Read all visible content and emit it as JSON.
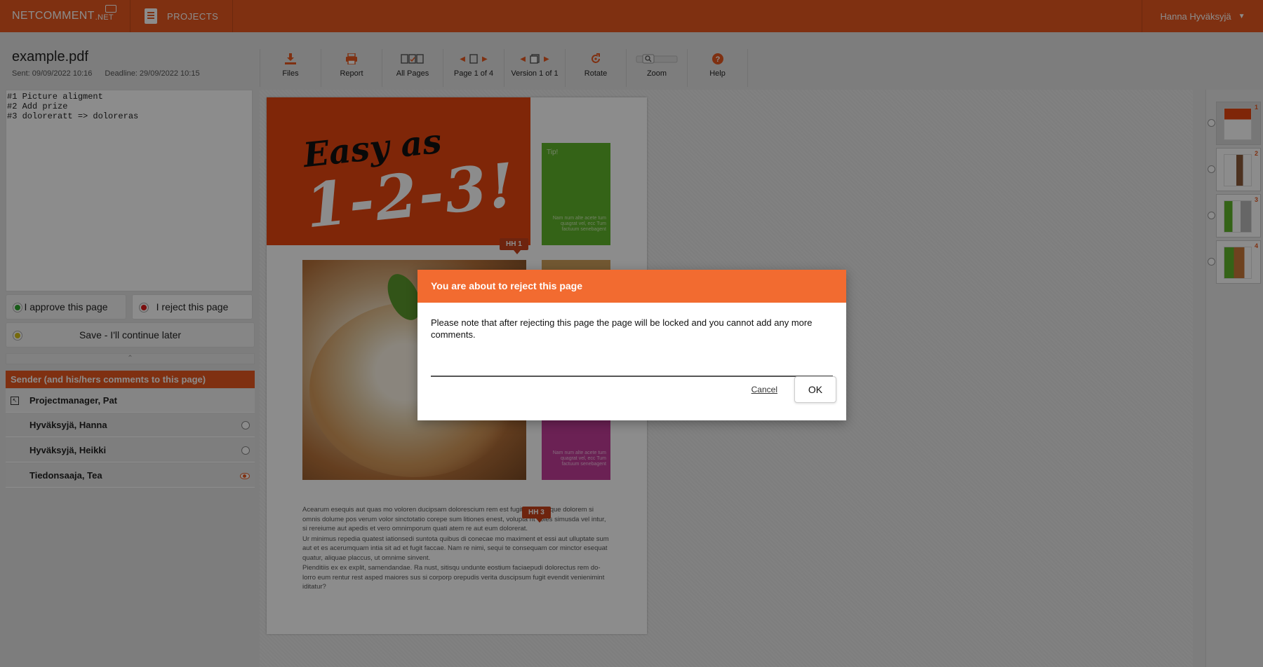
{
  "app": {
    "logo_text": "NETCOMMENT",
    "logo_suffix": ".NET",
    "projects_label": "PROJECTS",
    "user_name": "Hanna Hyväksyjä",
    "user_caret": "▼"
  },
  "file": {
    "name": "example.pdf",
    "sent": "Sent: 09/09/2022 10:16",
    "deadline": "Deadline: 29/09/2022 10:15"
  },
  "toolbar": {
    "files": "Files",
    "report": "Report",
    "all_pages": "All Pages",
    "page": "Page 1 of 4",
    "version": "Version 1 of 1",
    "rotate": "Rotate",
    "zoom": "Zoom",
    "help": "Help"
  },
  "notes": "#1 Picture aligment\n#2 Add prize\n#3 doloreratt => doloreras",
  "actions": {
    "approve": "I approve this page",
    "reject": "I reject this page",
    "save": "Save - I'll continue later",
    "approve_color": "#2ea82e",
    "reject_color": "#e01b1b",
    "save_color": "#d8c21a"
  },
  "sender": {
    "header": "Sender (and his/hers comments to this page)",
    "rows": [
      "Projectmanager, Pat",
      "Hyväksyjä, Hanna",
      "Hyväksyjä, Heikki",
      "Tiedonsaaja, Tea"
    ]
  },
  "page": {
    "title_1": "Easy as",
    "title_2": "1-2-3!",
    "tip_label": "Tip!",
    "tip_text": "Nam num alte acete tum quagrat vel, ecc Tum factuum senebagent",
    "pink_text": "Nam num alte acete tum quagrat vel, ecc Tum factuum senebagent",
    "paragraphs": [
      "Acearum esequis aut quas mo voloren ducipsam dolorescium rem est fugit posanit, que dolorem si omnis dolume pos verum volor sinctotatio corepe sum litiones enest, volupta nt voles simusda vel intur, si rereiume aut apedis et vero omnimporum quati atem re aut eum dolorerat.",
      "Ur minimus repedia quatest iationsedi suntota quibus di conecae mo maximent et essi aut ulluptate sum aut et es acerumquam intia sit ad et fugit faccae. Nam re nimi, sequi te consequam cor minctor esequat quatur, aliquae placcus, ut omnime sinvent.",
      "Pienditiis ex ex explit, samendandae. Ra nust, sitisqu undunte eostium faciaepudi dolorectus rem do-lorro eum rentur rest asped maiores sus si corporp orepudis verita duscipsum fugit evendit venienimint iditatur?"
    ],
    "markers": [
      "HH 1",
      "HH 3"
    ]
  },
  "thumbnails": [
    "1",
    "2",
    "3",
    "4"
  ],
  "dialog": {
    "title": "You are about to reject this page",
    "message": "Please note that after rejecting this page the page will be locked and you cannot add any more comments.",
    "input_value": "",
    "cancel": "Cancel",
    "ok": "OK"
  },
  "colors": {
    "brand": "#e8581f",
    "dialog_header": "#f26b30"
  }
}
